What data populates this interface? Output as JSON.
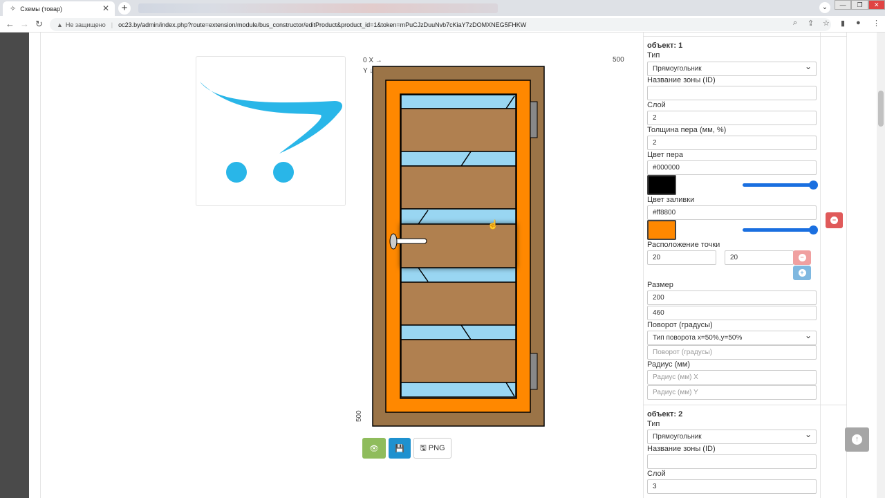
{
  "browser": {
    "tab_title": "Схемы (товар)",
    "tab_close": "✕",
    "new_tab": "+",
    "security": "Не защищено",
    "url": "oc23.by/admin/index.php?route=extension/module/bus_constructor/editProduct&product_id=1&token=mPuCJzDuuNvb7cKiaY7zDOMXNEG5FHKW",
    "window_buttons": [
      "—",
      "❐",
      "✕"
    ]
  },
  "scheme": {
    "axis_origin": "0 X →",
    "axis_y": "Y ↓",
    "axis_max_x": "500",
    "axis_max_y": "500"
  },
  "toolbar": {
    "png_label": "PNG"
  },
  "colors": {
    "brand_blue": "#29b6e8",
    "frame_outer": "#9b7447",
    "frame_orange": "#ff8800",
    "panel_wood": "#b08050",
    "glass": "#99d6f2",
    "pen_black": "#000000",
    "slider": "#1a6fe0",
    "remove_red": "#e05a5a"
  },
  "objects": [
    {
      "header": "объект: 1",
      "type_label": "Тип",
      "type_value": "Прямоугольник",
      "zone_label": "Название зоны (ID)",
      "zone_value": "",
      "layer_label": "Слой",
      "layer_value": "2",
      "pen_width_label": "Толщина пера (мм, %)",
      "pen_width_value": "2",
      "pen_color_label": "Цвет пера",
      "pen_color_value": "#000000",
      "pen_opacity": 1.0,
      "fill_color_label": "Цвет заливки",
      "fill_color_value": "#ff8800",
      "fill_opacity": 1.0,
      "point_label": "Расположение точки",
      "point_x": "20",
      "point_y": "20",
      "size_label": "Размер",
      "size_w": "200",
      "size_h": "460",
      "rotation_label": "Поворот (градусы)",
      "rotation_type": "Тип поворота x=50%,y=50%",
      "rotation_placeholder": "Поворот (градусы)",
      "radius_label": "Радиус (мм)",
      "radius_x_placeholder": "Радиус (мм) X",
      "radius_y_placeholder": "Радиус (мм) Y"
    },
    {
      "header": "объект: 2",
      "type_label": "Тип",
      "type_value": "Прямоугольник",
      "zone_label": "Название зоны (ID)",
      "zone_value": "",
      "layer_label": "Слой",
      "layer_value": "3"
    }
  ]
}
